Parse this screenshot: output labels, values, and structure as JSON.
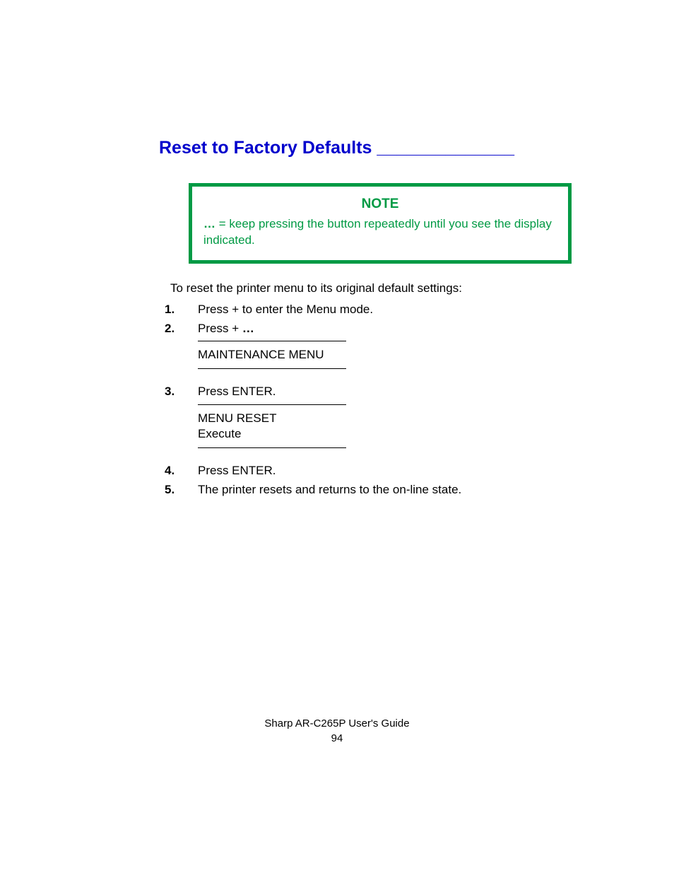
{
  "heading": "Reset to Factory Defaults ______________",
  "note": {
    "title": "NOTE",
    "ellipsis": "…",
    "text": " = keep pressing the button repeatedly until you see the display indicated."
  },
  "intro": "To reset the printer menu to its original default settings:",
  "steps": {
    "n1": "1.",
    "t1a": "Press ",
    "t1_plus": "+",
    "t1b": " to enter the Menu mode.",
    "n2": "2.",
    "t2a": "Press ",
    "t2_plus": "+",
    "t2_space": " ",
    "t2_ellipsis": "…",
    "display2": "MAINTENANCE MENU",
    "n3": "3.",
    "t3": "Press ENTER.",
    "display3a": "MENU RESET",
    "display3b": "Execute",
    "n4": "4.",
    "t4": "Press ENTER.",
    "n5": "5.",
    "t5": "The printer resets and returns to the on-line state."
  },
  "footer": {
    "title": "Sharp AR-C265P User's Guide",
    "page": "94"
  }
}
